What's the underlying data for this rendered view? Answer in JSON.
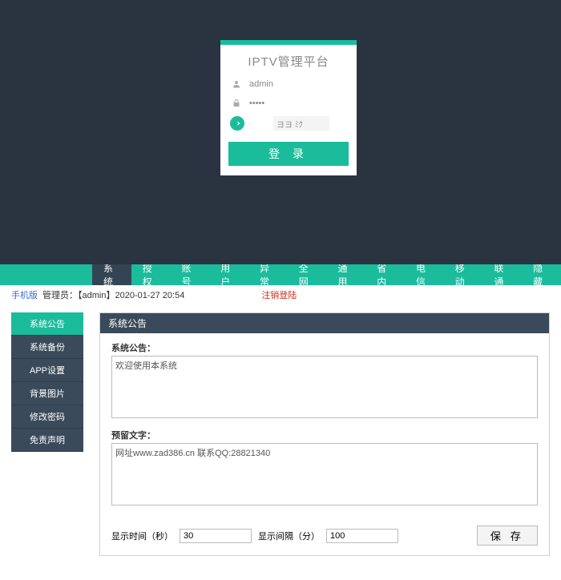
{
  "login": {
    "title": "IPTV管理平台",
    "username_value": "admin",
    "password_value": "•••••",
    "captcha_value": "",
    "captcha_display": "ヨヨ ﾐｸ",
    "submit_label": "登 录"
  },
  "topnav": {
    "items": [
      {
        "label": "系统",
        "active": true
      },
      {
        "label": "授权"
      },
      {
        "label": "账号"
      },
      {
        "label": "用户"
      },
      {
        "label": "异常"
      },
      {
        "label": "全网"
      },
      {
        "label": "通用"
      },
      {
        "label": "省内"
      },
      {
        "label": "电信"
      },
      {
        "label": "移动"
      },
      {
        "label": "联通"
      },
      {
        "label": "隐藏"
      }
    ]
  },
  "infobar": {
    "mobile_link": "手机版",
    "admin_text": "管理员：【admin】2020-01-27 20:54",
    "logout": "注销登陆"
  },
  "sidebar": {
    "items": [
      {
        "label": "系统公告",
        "active": true
      },
      {
        "label": "系统备份"
      },
      {
        "label": "APP设置"
      },
      {
        "label": "背景图片"
      },
      {
        "label": "修改密码"
      },
      {
        "label": "免责声明"
      }
    ]
  },
  "panel": {
    "header": "系统公告",
    "announce_label": "系统公告：",
    "announce_value": "欢迎使用本系统",
    "reserve_label": "预留文字：",
    "reserve_value": "网址www.zad386.cn 联系QQ:28821340",
    "show_seconds_label": "显示时间（秒）",
    "show_seconds_value": "30",
    "show_interval_label": "显示间隔（分）",
    "show_interval_value": "100",
    "save_label": "保 存"
  }
}
